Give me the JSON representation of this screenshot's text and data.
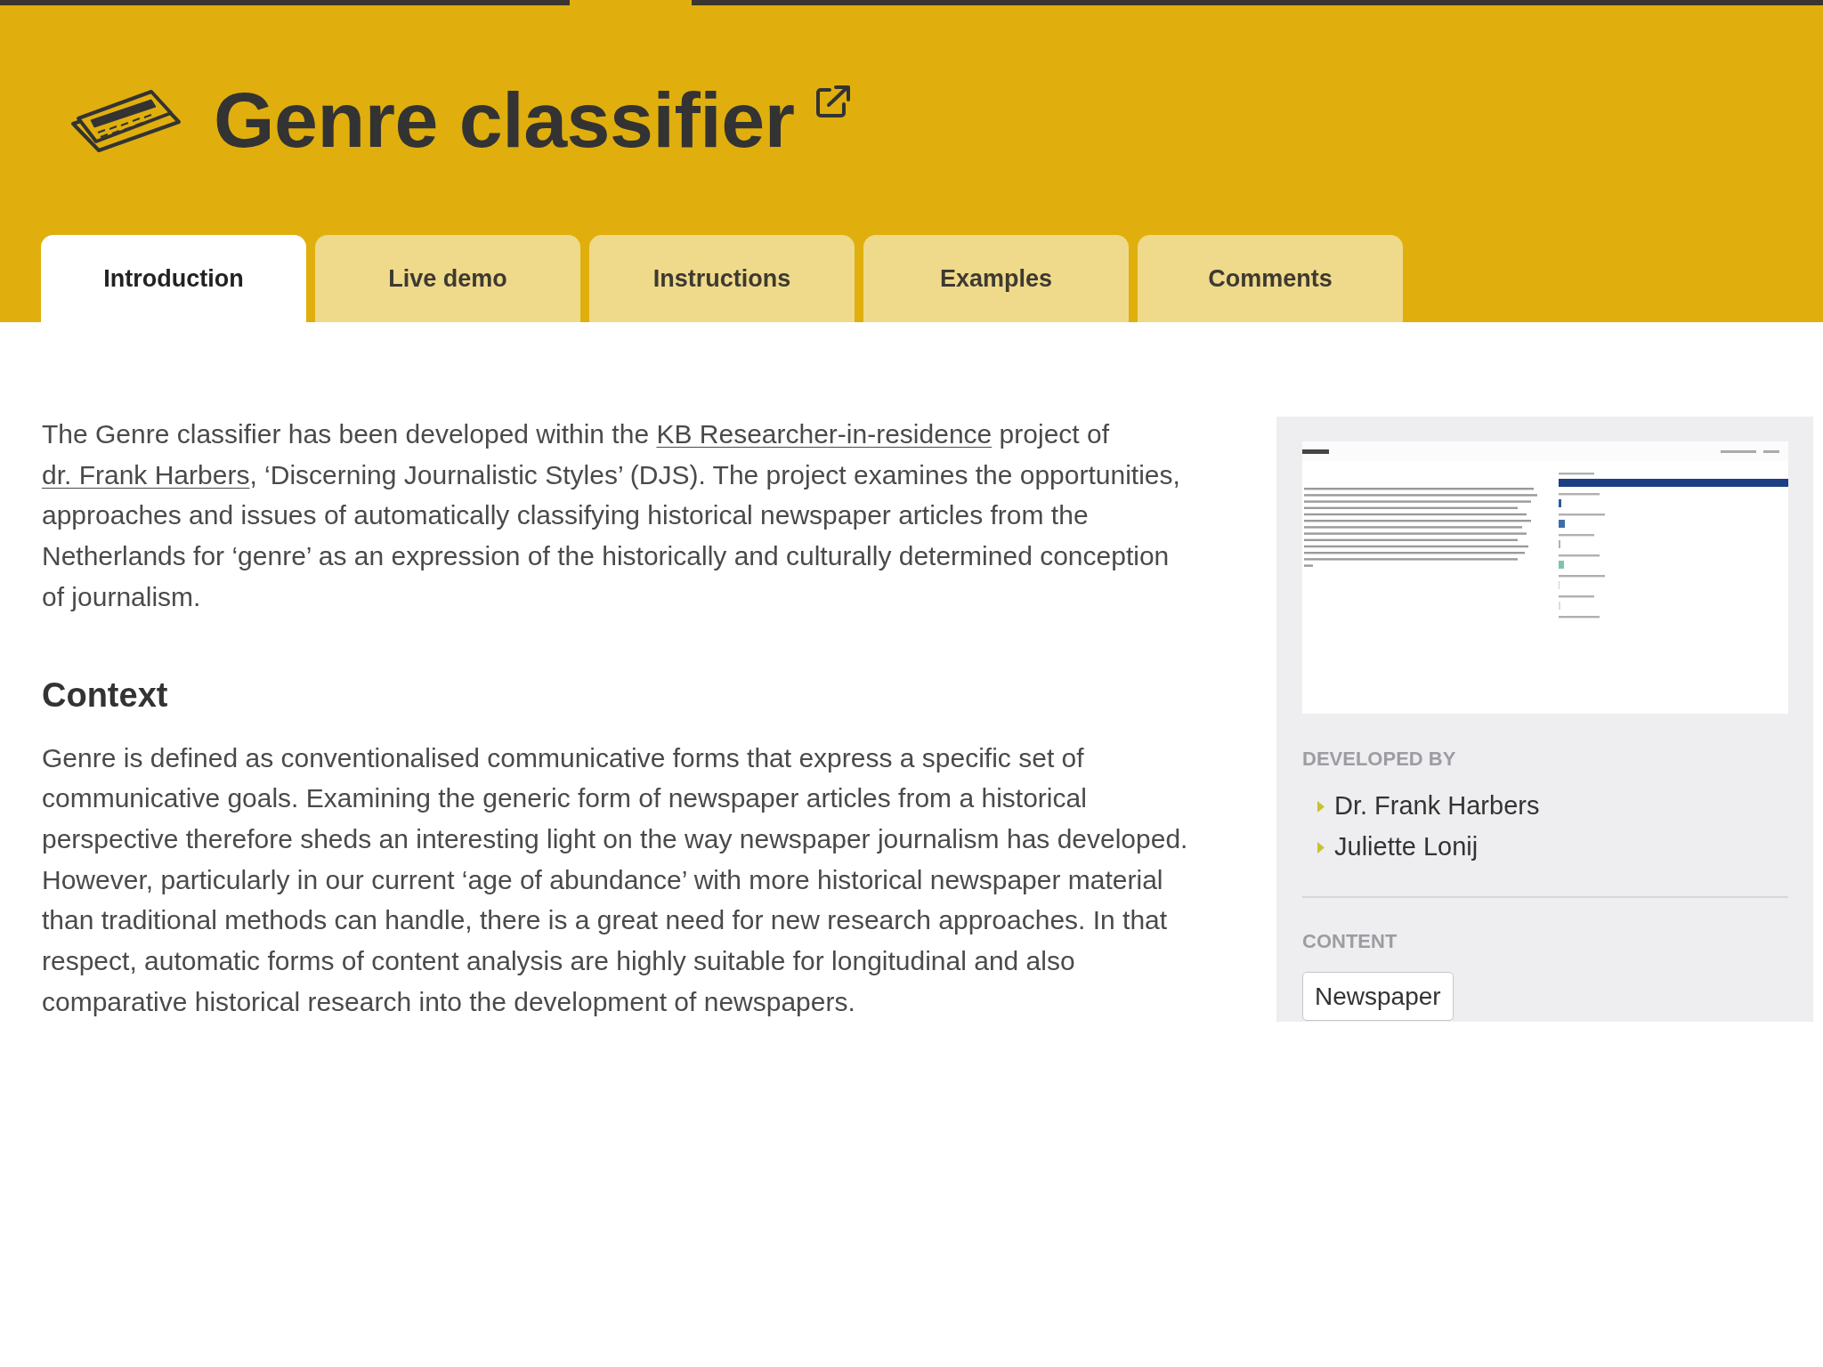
{
  "header": {
    "title": "Genre classifier"
  },
  "tabs": [
    {
      "label": "Introduction",
      "selected": true
    },
    {
      "label": "Live demo",
      "selected": false
    },
    {
      "label": "Instructions",
      "selected": false
    },
    {
      "label": "Examples",
      "selected": false
    },
    {
      "label": "Comments",
      "selected": false
    }
  ],
  "intro": {
    "parts": [
      {
        "kind": "text",
        "text": "The Genre classifier has been developed within the "
      },
      {
        "kind": "link",
        "text": "KB Researcher-in-residence"
      },
      {
        "kind": "text",
        "text": " project of "
      },
      {
        "kind": "link",
        "text": "dr. Frank Harbers"
      },
      {
        "kind": "text",
        "text": ", ‘Discerning Journalistic Styles’ (DJS). The project examines the opportunities, approaches and issues of automatically classifying historical newspaper articles from the Netherlands for ‘genre’ as an expression of the historically and culturally determined conception of journalism."
      }
    ]
  },
  "context": {
    "heading": "Context",
    "text": "Genre is defined as conventionalised communicative forms that express a specific set of communicative goals. Examining the generic form of newspaper articles from a historical perspective therefore sheds an interesting light on the way newspaper journalism has developed. However, particularly in our current ‘age of abundance’ with more historical newspaper material than traditional methods can handle, there is a great need for new research approaches. In that respect, automatic forms of content analysis are highly suitable for longitudinal and also comparative historical research into the development of newspapers."
  },
  "sidebar": {
    "developed_by": {
      "label": "DEVELOPED BY",
      "people": [
        "Dr. Frank Harbers",
        "Juliette Lonij"
      ]
    },
    "content": {
      "label": "CONTENT",
      "tags": [
        "Newspaper"
      ]
    }
  }
}
